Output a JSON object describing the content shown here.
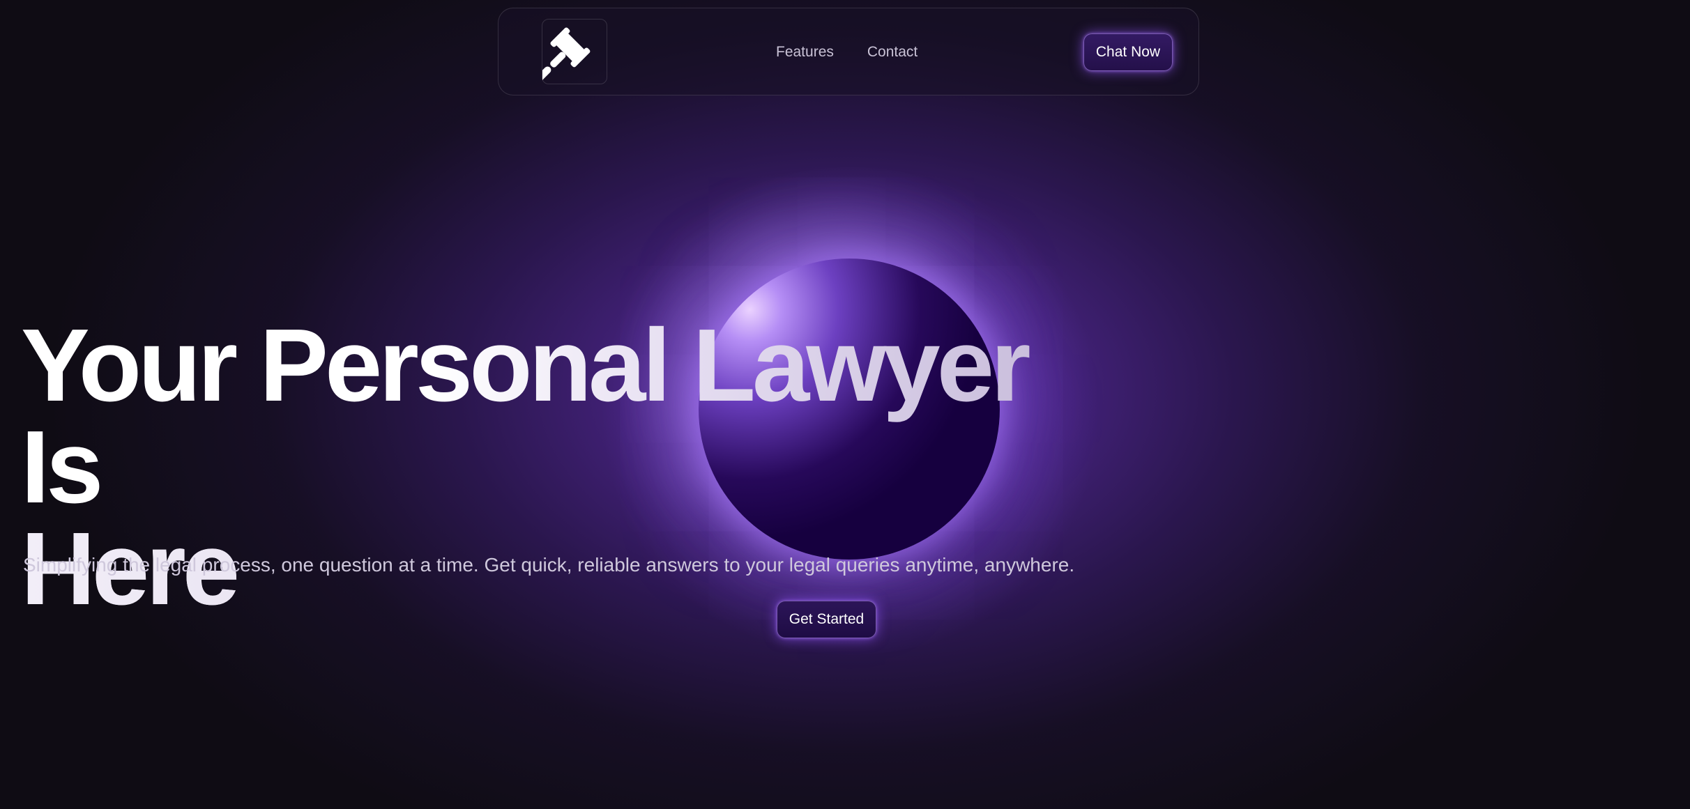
{
  "nav": {
    "logo_icon": "gavel-icon",
    "links": [
      "Features",
      "Contact"
    ],
    "cta_label": "Chat Now"
  },
  "hero": {
    "title_line1": "Your Personal Lawyer Is",
    "title_line2": "Here",
    "subtitle": "Simplifying the legal process, one question at a time. Get quick, reliable answers to your legal queries anytime, anywhere.",
    "cta_label": "Get Started"
  },
  "colors": {
    "background": "#0f0c14",
    "accent_purple": "#703cbe",
    "orb_core": "#16003f",
    "button_bg": "#2c1558"
  }
}
